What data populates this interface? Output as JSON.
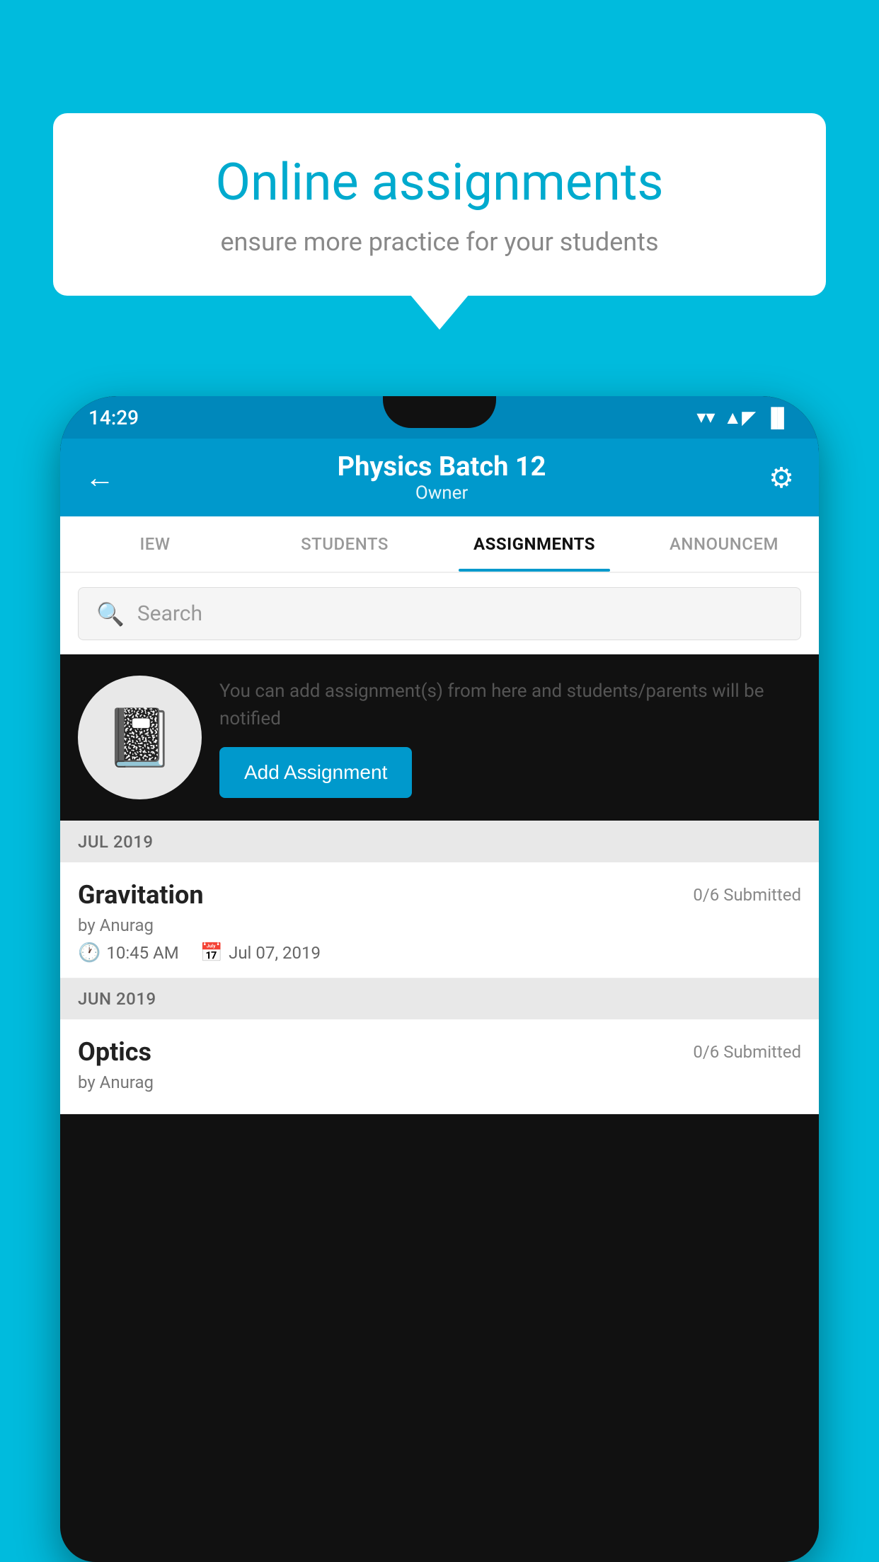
{
  "background_color": "#00BBDD",
  "speech_bubble": {
    "title": "Online assignments",
    "subtitle": "ensure more practice for your students"
  },
  "status_bar": {
    "time": "14:29",
    "wifi": "▼",
    "signal": "▲",
    "battery": "▐"
  },
  "app_header": {
    "back_icon": "←",
    "title": "Physics Batch 12",
    "subtitle": "Owner",
    "settings_icon": "⚙"
  },
  "tabs": [
    {
      "label": "IEW",
      "active": false
    },
    {
      "label": "STUDENTS",
      "active": false
    },
    {
      "label": "ASSIGNMENTS",
      "active": true
    },
    {
      "label": "ANNOUNCEM",
      "active": false
    }
  ],
  "search": {
    "placeholder": "Search",
    "icon": "🔍"
  },
  "promo": {
    "description": "You can add assignment(s) from here and students/parents will be notified",
    "button_label": "Add Assignment"
  },
  "sections": [
    {
      "label": "JUL 2019",
      "assignments": [
        {
          "name": "Gravitation",
          "submitted": "0/6 Submitted",
          "by": "by Anurag",
          "time": "10:45 AM",
          "date": "Jul 07, 2019"
        }
      ]
    },
    {
      "label": "JUN 2019",
      "assignments": [
        {
          "name": "Optics",
          "submitted": "0/6 Submitted",
          "by": "by Anurag",
          "time": "",
          "date": ""
        }
      ]
    }
  ]
}
